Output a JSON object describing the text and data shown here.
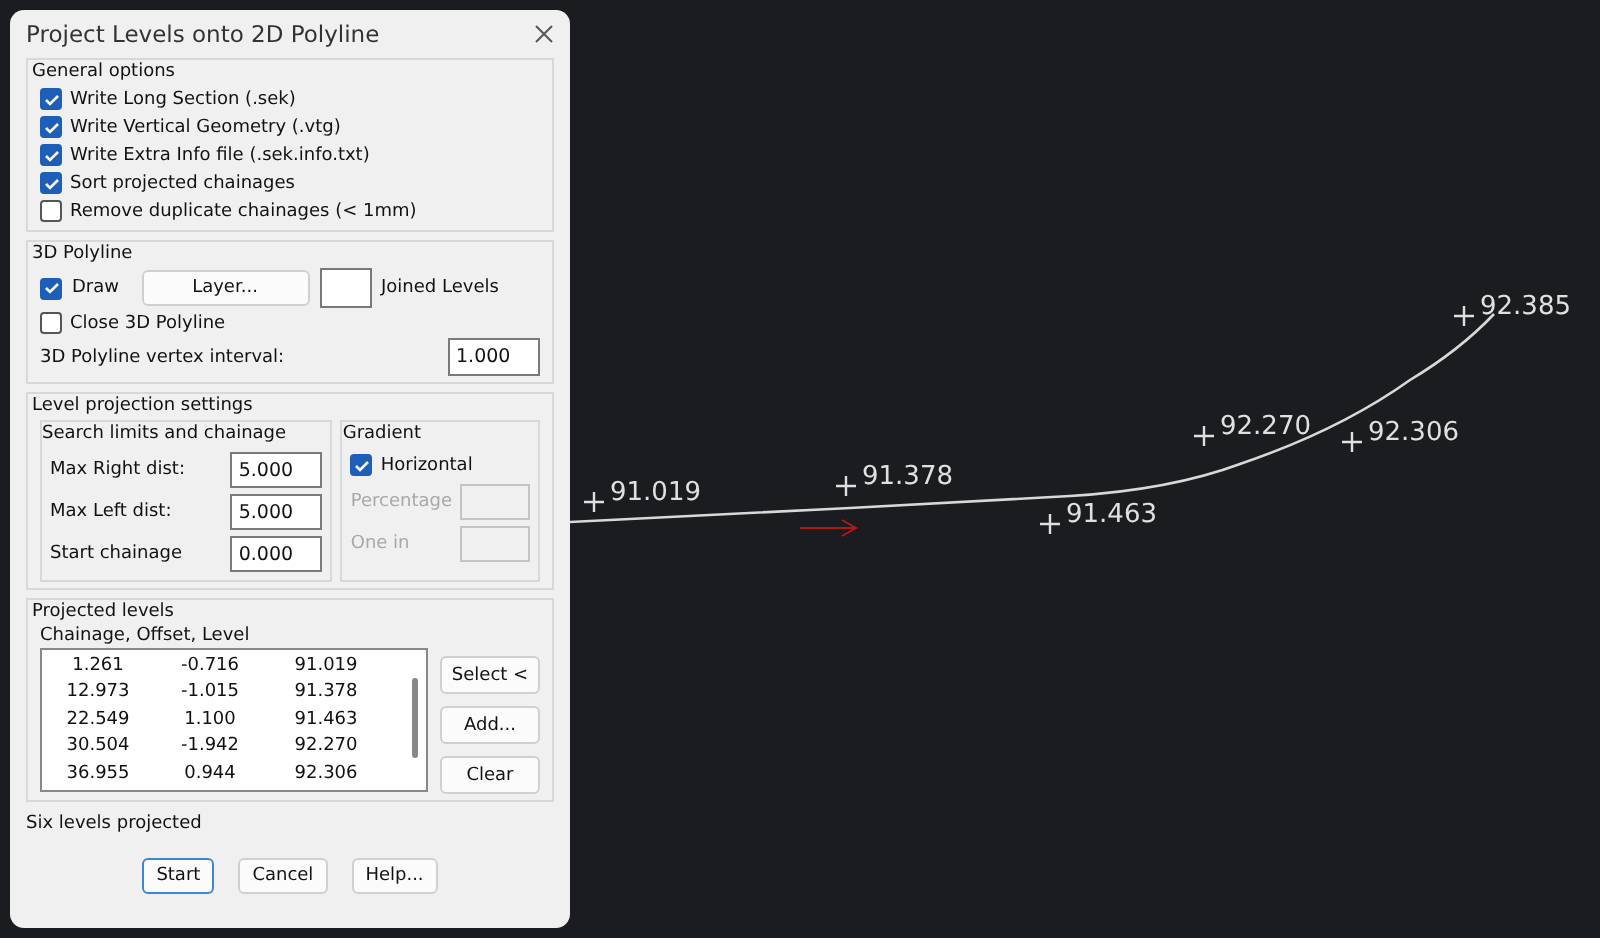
{
  "dialog": {
    "title": "Project Levels onto 2D Polyline",
    "general_options": {
      "title": "General options",
      "options": [
        {
          "label": "Write Long Section (.sek)",
          "checked": true
        },
        {
          "label": "Write Vertical Geometry (.vtg)",
          "checked": true
        },
        {
          "label": "Write Extra Info file (.sek.info.txt)",
          "checked": true
        },
        {
          "label": "Sort projected chainages",
          "checked": true
        },
        {
          "label": "Remove duplicate chainages (< 1mm)",
          "checked": false
        }
      ]
    },
    "polyline_3d": {
      "title": "3D Polyline",
      "draw": {
        "label": "Draw",
        "checked": true
      },
      "layer_button": "Layer...",
      "joined_levels_label": "Joined Levels",
      "close": {
        "label": "Close 3D Polyline",
        "checked": false
      },
      "interval_label": "3D Polyline vertex interval:",
      "interval_value": "1.000"
    },
    "level_projection": {
      "title": "Level projection settings",
      "search": {
        "title": "Search limits and chainage",
        "fields": [
          {
            "label": "Max Right dist:",
            "value": "5.000"
          },
          {
            "label": "Max Left dist:",
            "value": "5.000"
          },
          {
            "label": "Start chainage",
            "value": "0.000"
          }
        ]
      },
      "gradient": {
        "title": "Gradient",
        "horizontal": {
          "label": "Horizontal",
          "checked": true
        },
        "fields": [
          {
            "label": "Percentage",
            "disabled": true
          },
          {
            "label": "One in",
            "disabled": true
          }
        ]
      }
    },
    "projected_levels": {
      "title": "Projected levels",
      "list_header": "Chainage, Offset, Level",
      "rows": [
        [
          "1.261",
          "-0.716",
          "91.019"
        ],
        [
          "12.973",
          "-1.015",
          "91.378"
        ],
        [
          "22.549",
          "1.100",
          "91.463"
        ],
        [
          "30.504",
          "-1.942",
          "92.270"
        ],
        [
          "36.955",
          "0.944",
          "92.306"
        ]
      ],
      "buttons": [
        "Select <",
        "Add...",
        "Clear"
      ]
    },
    "status": "Six levels projected",
    "buttons": [
      {
        "label": "Start",
        "selected": true
      },
      {
        "label": "Cancel",
        "selected": false
      },
      {
        "label": "Help...",
        "selected": false
      }
    ]
  },
  "canvas": {
    "points": [
      {
        "label": "91.019"
      },
      {
        "label": "91.378"
      },
      {
        "label": "91.463"
      },
      {
        "label": "92.270"
      },
      {
        "label": "92.306"
      },
      {
        "label": "92.385"
      }
    ]
  }
}
